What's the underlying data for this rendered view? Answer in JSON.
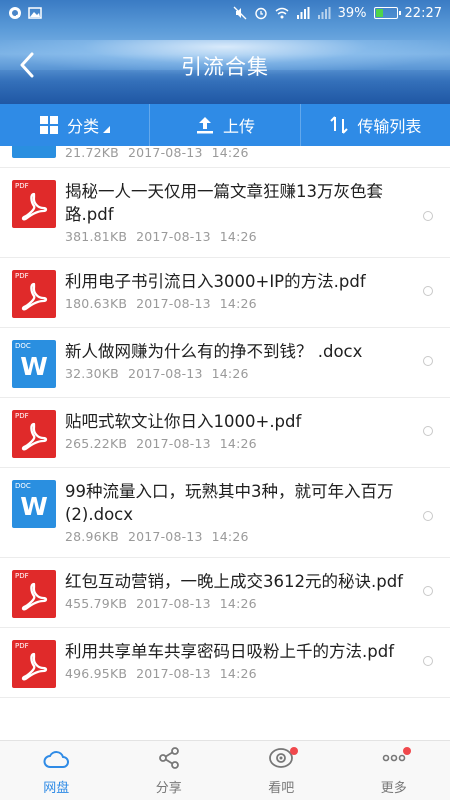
{
  "status_bar": {
    "battery": "39%",
    "battery_level": 0.39,
    "time": "22:27"
  },
  "header": {
    "title": "引流合集"
  },
  "toolbar": {
    "category_label": "分类",
    "upload_label": "上传",
    "transfer_label": "传输列表"
  },
  "partial_file": {
    "size": "21.72KB",
    "date": "2017-08-13",
    "time": "14:26"
  },
  "files": [
    {
      "type": "pdf",
      "tag": "PDF",
      "name": "揭秘一人一天仅用一篇文章狂赚13万灰色套路.pdf",
      "size": "381.81KB",
      "date": "2017-08-13",
      "time": "14:26"
    },
    {
      "type": "pdf",
      "tag": "PDF",
      "name": "利用电子书引流日入3000+IP的方法.pdf",
      "size": "180.63KB",
      "date": "2017-08-13",
      "time": "14:26"
    },
    {
      "type": "doc",
      "tag": "DOC",
      "name": "新人做网赚为什么有的挣不到钱？ .docx",
      "size": "32.30KB",
      "date": "2017-08-13",
      "time": "14:26"
    },
    {
      "type": "pdf",
      "tag": "PDF",
      "name": "贴吧式软文让你日入1000+.pdf",
      "size": "265.22KB",
      "date": "2017-08-13",
      "time": "14:26"
    },
    {
      "type": "doc",
      "tag": "DOC",
      "name": "99种流量入口，玩熟其中3种，就可年入百万 (2).docx",
      "size": "28.96KB",
      "date": "2017-08-13",
      "time": "14:26"
    },
    {
      "type": "pdf",
      "tag": "PDF",
      "name": "红包互动营销，一晚上成交3612元的秘诀.pdf",
      "size": "455.79KB",
      "date": "2017-08-13",
      "time": "14:26"
    },
    {
      "type": "pdf",
      "tag": "PDF",
      "name": "利用共享单车共享密码日吸粉上千的方法.pdf",
      "size": "496.95KB",
      "date": "2017-08-13",
      "time": "14:26"
    }
  ],
  "bottom_nav": {
    "items": [
      {
        "label": "网盘",
        "icon": "cloud-icon",
        "active": true,
        "badge": false
      },
      {
        "label": "分享",
        "icon": "share-icon",
        "active": false,
        "badge": false
      },
      {
        "label": "看吧",
        "icon": "eye-icon",
        "active": false,
        "badge": true
      },
      {
        "label": "更多",
        "icon": "more-icon",
        "active": false,
        "badge": true
      }
    ]
  },
  "colors": {
    "accent": "#2f8be6",
    "pdf": "#e02a2a",
    "doc": "#2a8fe0",
    "badge": "#f0484c"
  }
}
